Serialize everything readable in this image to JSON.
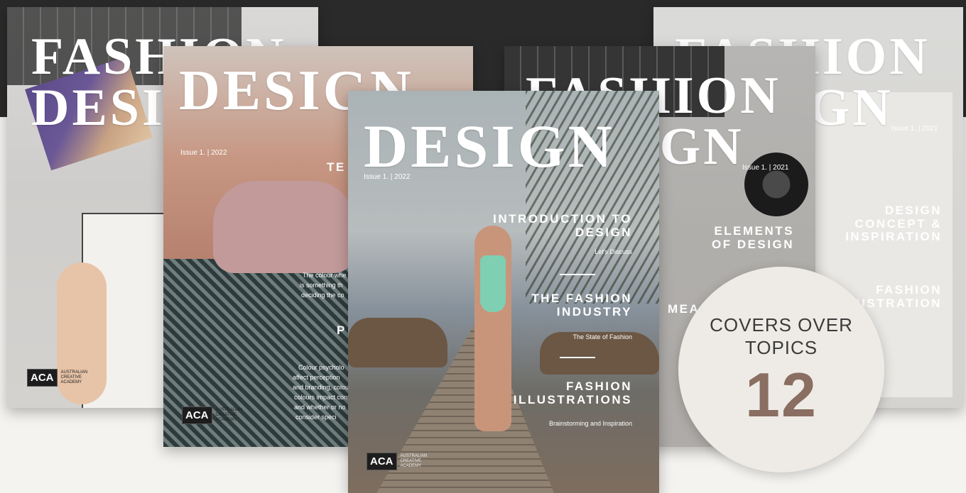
{
  "badge": {
    "line1": "COVERS OVER",
    "line2": "TOPICS",
    "number": "12"
  },
  "covers": {
    "back_left": {
      "masthead_1": "FASHION",
      "masthead_2": "DESIGN",
      "logo_mark": "ACA",
      "logo_text": "AUSTRALIAN\nCREATIVE\nACADEMY"
    },
    "mid_left": {
      "masthead": "DESIGN",
      "issue": "Issue 1. | 2022",
      "topic_partial": "TE",
      "topic2_partial": "P",
      "body_1": "The colour whe",
      "body_2": "is something th",
      "body_3": "deciding the co",
      "body_4": "Colour psycholo",
      "body_5": "affect perception",
      "body_6": "and branding, colour",
      "body_7": "colours impact cons",
      "body_8": "and whether or no",
      "body_9": "consider speci",
      "logo_mark": "ACA",
      "logo_text": "AUSTRALIAN\nCREATIVE\nACADEMY"
    },
    "front": {
      "masthead": "DESIGN",
      "issue": "Issue 1. | 2022",
      "topic_1": "INTRODUCTION TO\nDESIGN",
      "sub_1": "Let's Discuss",
      "topic_2": "THE FASHION\nINDUSTRY",
      "sub_2": "The State of Fashion",
      "topic_3": "FASHION\nILLUSTRATIONS",
      "sub_3": "Brainstorming and Inspiration",
      "logo_mark": "ACA",
      "logo_text": "AUSTRALIAN\nCREATIVE\nACADEMY"
    },
    "mid_right": {
      "masthead_1": "FASHION",
      "masthead_2": "DESIGN",
      "issue": "Issue 1. | 2021",
      "topic_1": "ELEMENTS\nOF DESIGN",
      "topic_partial": "MEA"
    },
    "back_right": {
      "masthead_1": "FASHION",
      "masthead_2": "DESIGN",
      "issue": "Issue 1. | 2021",
      "topic_1": "DESIGN\nCONCEPT &\nINSPIRATION",
      "topic_2": "FASHION\nILLUSTRATION"
    }
  }
}
